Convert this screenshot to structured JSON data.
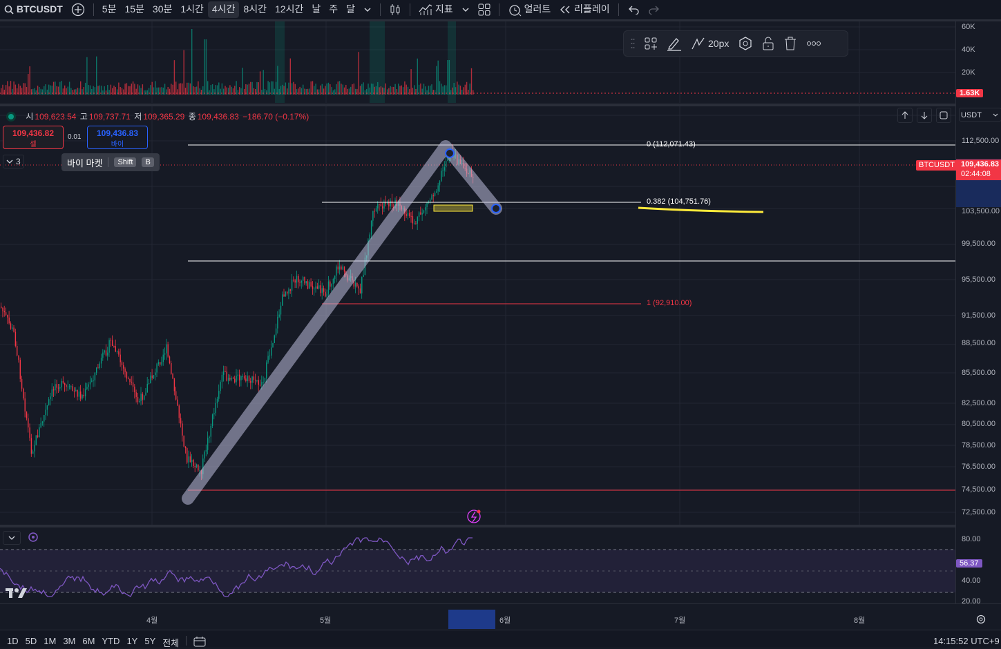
{
  "toolbar": {
    "symbol": "BTCUSDT",
    "intervals": [
      "5분",
      "15분",
      "30분",
      "1시간",
      "4시간",
      "8시간",
      "12시간",
      "날",
      "주",
      "달"
    ],
    "active_interval": "4시간",
    "indicators_label": "지표",
    "alert_label": "얼러트",
    "replay_label": "리플레이"
  },
  "legend": {
    "open_label": "시",
    "open": "109,623.54",
    "high_label": "고",
    "high": "109,737.71",
    "low_label": "저",
    "low": "109,365.29",
    "close_label": "종",
    "close": "109,436.83",
    "change": "−186.70 (−0.17%)"
  },
  "trade": {
    "sell_price": "109,436.82",
    "sell_label": "셀",
    "spread": "0.01",
    "buy_price": "109,436.83",
    "buy_label": "바이",
    "tooltip_label": "바이 마켓",
    "key1": "Shift",
    "key2": "B",
    "collapse_count": "3"
  },
  "drawing_toolbar": {
    "width_label": "20px"
  },
  "fib": {
    "level0": "0 (112,071.43)",
    "level382": "0.382 (104,751.76)",
    "level1": "1 (92,910.00)"
  },
  "price_axis": {
    "currency": "USDT",
    "labels": [
      "112,500.00",
      "103,500.00",
      "99,500.00",
      "95,500.00",
      "91,500.00",
      "88,500.00",
      "85,500.00",
      "82,500.00",
      "80,500.00",
      "78,500.00",
      "76,500.00",
      "74,500.00",
      "72,500.00"
    ],
    "current_symbol": "BTCUSDT",
    "current_price": "109,436.83",
    "countdown": "02:44:08"
  },
  "volume_axis": {
    "labels": [
      "60K",
      "40K",
      "20K"
    ],
    "current": "1.63K"
  },
  "rsi_axis": {
    "labels": [
      "80.00",
      "40.00",
      "20.00"
    ],
    "current": "56.37"
  },
  "time_axis": {
    "labels": [
      "4월",
      "5월",
      "6월",
      "7월",
      "8월"
    ]
  },
  "bottom": {
    "ranges": [
      "1D",
      "5D",
      "1M",
      "3M",
      "6M",
      "YTD",
      "1Y",
      "5Y",
      "전체"
    ],
    "clock": "14:15:52 UTC+9"
  },
  "colors": {
    "up": "#089981",
    "down": "#f23645",
    "accent": "#2962ff",
    "rsi": "#7e57c2",
    "highlight": "#ffeb3b"
  }
}
